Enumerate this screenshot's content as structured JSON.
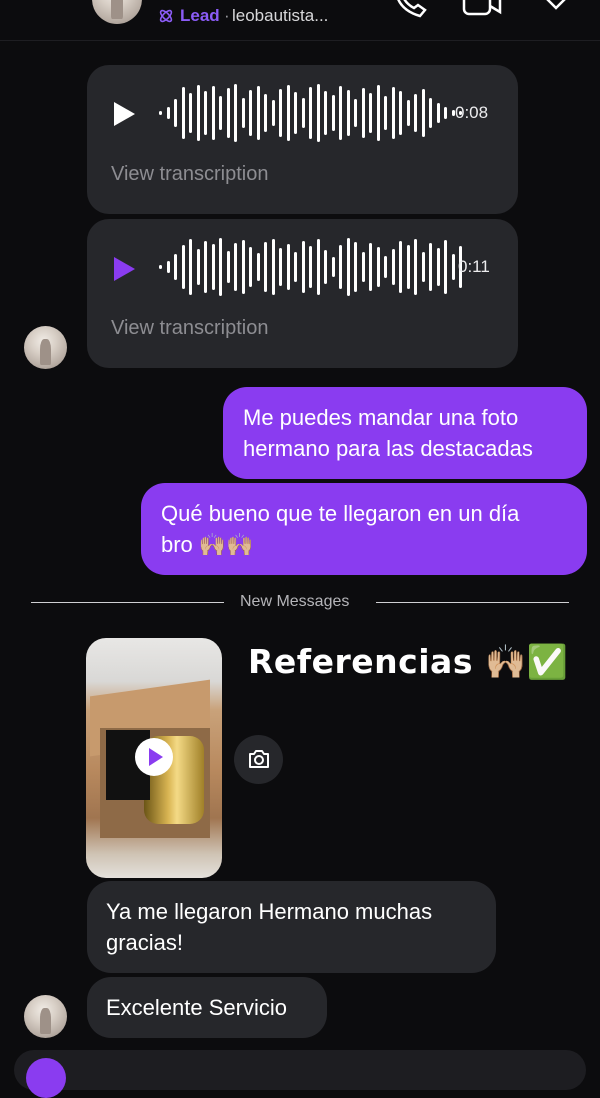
{
  "header": {
    "lead_label": "Lead",
    "separator": "·",
    "username": "leobautista..."
  },
  "messages": {
    "audio_1": {
      "duration": "0:08",
      "transcription_link": "View transcription",
      "state": "paused"
    },
    "audio_2": {
      "duration": "0:11",
      "transcription_link": "View transcription",
      "state": "playing"
    },
    "out_1": {
      "lines": [
        "Me puedes mandar una foto",
        "hermano para las destacadas"
      ]
    },
    "out_2": {
      "lines": [
        "Qué bueno que te llegaron en un día",
        "bro 🙌🏼🙌🏼"
      ]
    },
    "divider_label": "New Messages",
    "reel_caption": "Referencias 🙌🏼✅",
    "in_1": {
      "lines": [
        "Ya me llegaron Hermano muchas",
        "gracias!"
      ]
    },
    "in_2": {
      "text": "Excelente Servicio"
    }
  },
  "colors": {
    "accent": "#8a3cf0",
    "lead": "#8b5cf6",
    "background": "#0c0c0e",
    "incoming_bubble": "#26272b"
  }
}
